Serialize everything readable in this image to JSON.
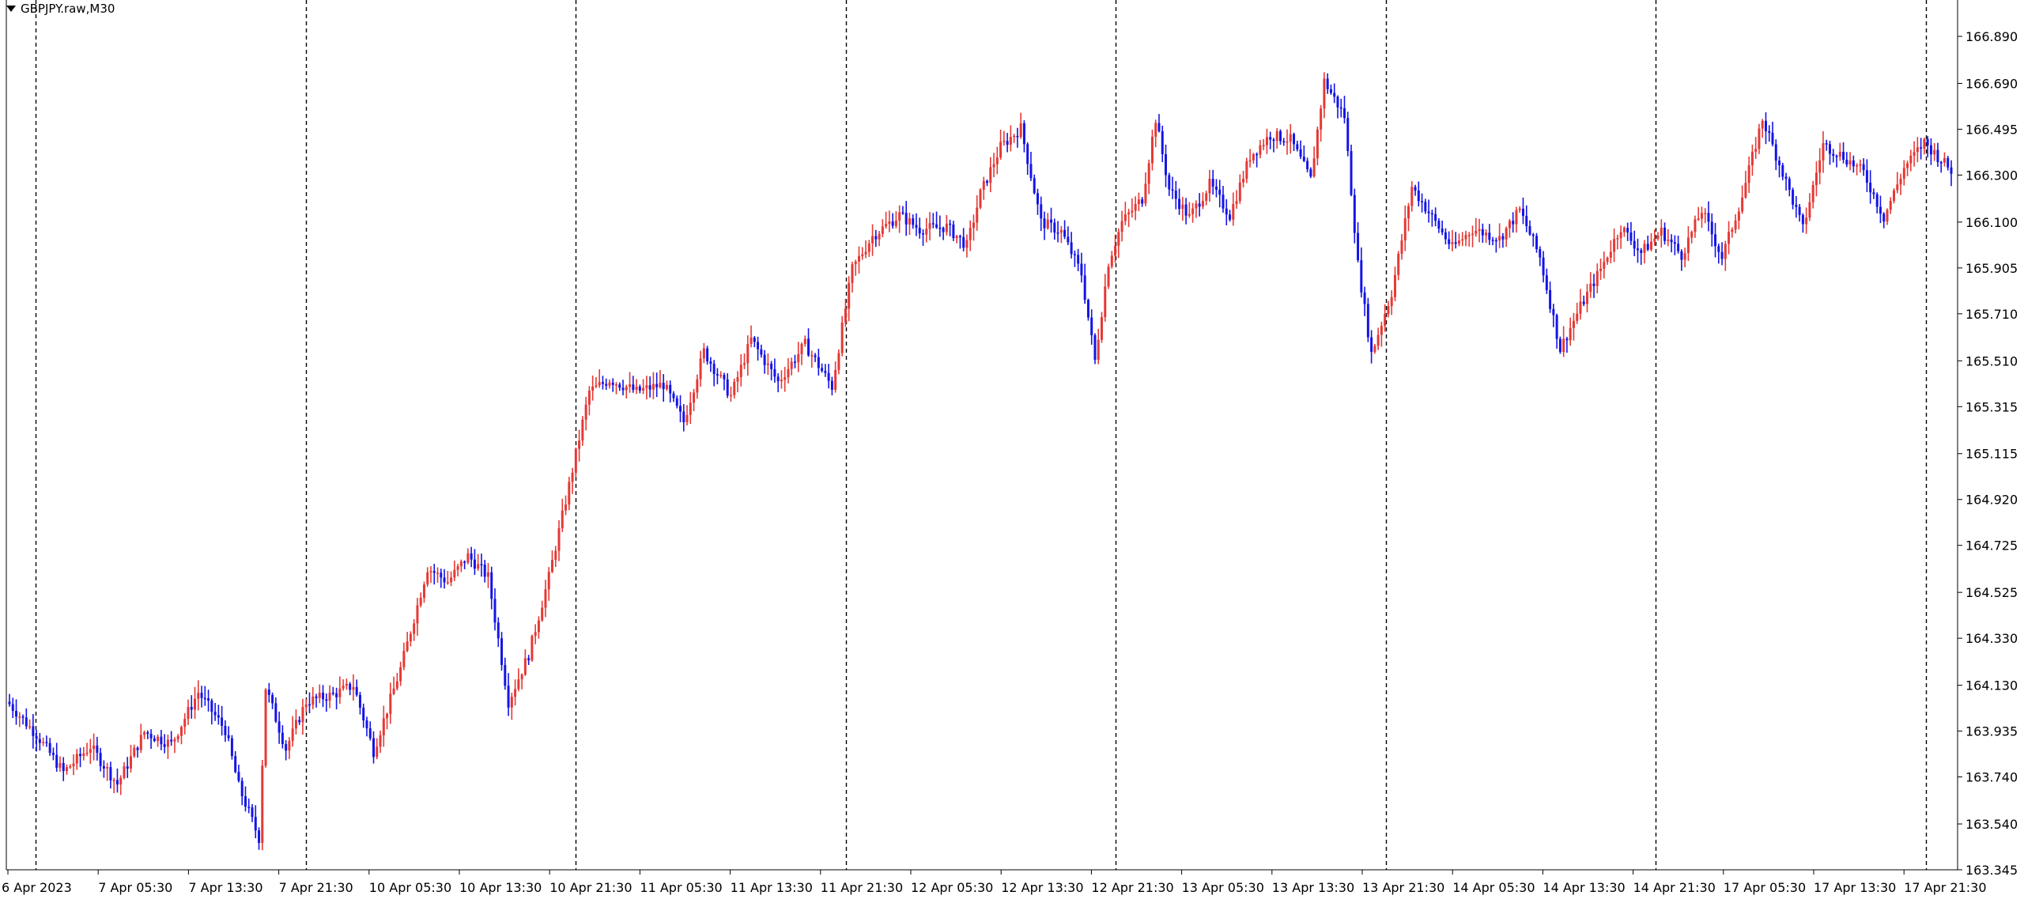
{
  "window": {
    "title": "GBPJPY.raw,M30",
    "menu_icon": "triangle-down-icon"
  },
  "colors": {
    "bull": "#e53935",
    "bear": "#1414e6",
    "grid": "#000000",
    "axis": "#000000",
    "background": "#ffffff"
  },
  "chart_data": {
    "type": "candlestick",
    "symbol": "GBPJPY.raw",
    "timeframe": "M30",
    "ylim": [
      163.345,
      166.89
    ],
    "y_ticks": [
      "166.890",
      "166.690",
      "166.495",
      "166.300",
      "166.100",
      "165.905",
      "165.710",
      "165.510",
      "165.315",
      "165.115",
      "164.920",
      "164.725",
      "164.525",
      "164.330",
      "164.130",
      "163.935",
      "163.740",
      "163.540",
      "163.345"
    ],
    "x_labels": [
      "6 Apr 2023",
      "7 Apr 05:30",
      "7 Apr 13:30",
      "7 Apr 21:30",
      "10 Apr 05:30",
      "10 Apr 13:30",
      "10 Apr 21:30",
      "11 Apr 05:30",
      "11 Apr 13:30",
      "11 Apr 21:30",
      "12 Apr 05:30",
      "12 Apr 13:30",
      "12 Apr 21:30",
      "13 Apr 05:30",
      "13 Apr 13:30",
      "13 Apr 21:30",
      "14 Apr 05:30",
      "14 Apr 13:30",
      "14 Apr 21:30",
      "17 Apr 05:30",
      "17 Apr 13:30",
      "17 Apr 21:30"
    ],
    "session_separators": [
      "7 Apr 00:00",
      "10 Apr 00:00",
      "11 Apr 00:00",
      "12 Apr 00:00",
      "13 Apr 00:00",
      "14 Apr 00:00",
      "17 Apr 00:00",
      "18 Apr 00:00"
    ],
    "grid": false,
    "ohlc_path": [
      [
        0,
        164.05
      ],
      [
        8,
        163.92
      ],
      [
        16,
        163.76
      ],
      [
        24,
        163.87
      ],
      [
        32,
        163.71
      ],
      [
        40,
        163.93
      ],
      [
        48,
        163.88
      ],
      [
        56,
        164.1
      ],
      [
        64,
        163.94
      ],
      [
        68,
        163.7
      ],
      [
        74,
        163.48
      ],
      [
        76,
        164.12
      ],
      [
        82,
        163.86
      ],
      [
        88,
        164.06
      ],
      [
        96,
        164.09
      ],
      [
        102,
        164.13
      ],
      [
        108,
        163.85
      ],
      [
        116,
        164.2
      ],
      [
        124,
        164.63
      ],
      [
        130,
        164.57
      ],
      [
        136,
        164.68
      ],
      [
        142,
        164.59
      ],
      [
        148,
        164.06
      ],
      [
        154,
        164.26
      ],
      [
        160,
        164.59
      ],
      [
        166,
        164.98
      ],
      [
        172,
        165.38
      ],
      [
        178,
        165.43
      ],
      [
        186,
        165.38
      ],
      [
        194,
        165.41
      ],
      [
        200,
        165.25
      ],
      [
        206,
        165.55
      ],
      [
        214,
        165.36
      ],
      [
        220,
        165.6
      ],
      [
        228,
        165.42
      ],
      [
        236,
        165.58
      ],
      [
        244,
        165.4
      ],
      [
        250,
        165.9
      ],
      [
        256,
        166.04
      ],
      [
        264,
        166.13
      ],
      [
        270,
        166.07
      ],
      [
        278,
        166.08
      ],
      [
        284,
        166.0
      ],
      [
        288,
        166.22
      ],
      [
        294,
        166.42
      ],
      [
        300,
        166.5
      ],
      [
        306,
        166.1
      ],
      [
        312,
        166.06
      ],
      [
        318,
        165.88
      ],
      [
        322,
        165.51
      ],
      [
        326,
        165.93
      ],
      [
        330,
        166.1
      ],
      [
        336,
        166.2
      ],
      [
        340,
        166.54
      ],
      [
        344,
        166.24
      ],
      [
        350,
        166.12
      ],
      [
        356,
        166.26
      ],
      [
        362,
        166.13
      ],
      [
        368,
        166.38
      ],
      [
        374,
        166.47
      ],
      [
        380,
        166.45
      ],
      [
        386,
        166.28
      ],
      [
        390,
        166.7
      ],
      [
        396,
        166.55
      ],
      [
        400,
        165.92
      ],
      [
        404,
        165.54
      ],
      [
        410,
        165.8
      ],
      [
        416,
        166.25
      ],
      [
        422,
        166.12
      ],
      [
        428,
        165.99
      ],
      [
        434,
        166.07
      ],
      [
        442,
        166.03
      ],
      [
        448,
        166.15
      ],
      [
        454,
        165.95
      ],
      [
        460,
        165.56
      ],
      [
        466,
        165.74
      ],
      [
        472,
        165.9
      ],
      [
        478,
        166.08
      ],
      [
        484,
        165.97
      ],
      [
        490,
        166.06
      ],
      [
        496,
        165.96
      ],
      [
        502,
        166.15
      ],
      [
        508,
        165.95
      ],
      [
        514,
        166.21
      ],
      [
        520,
        166.54
      ],
      [
        526,
        166.31
      ],
      [
        532,
        166.07
      ],
      [
        538,
        166.43
      ],
      [
        544,
        166.38
      ],
      [
        550,
        166.31
      ],
      [
        556,
        166.12
      ],
      [
        562,
        166.33
      ],
      [
        568,
        166.44
      ],
      [
        576,
        166.32
      ]
    ]
  }
}
